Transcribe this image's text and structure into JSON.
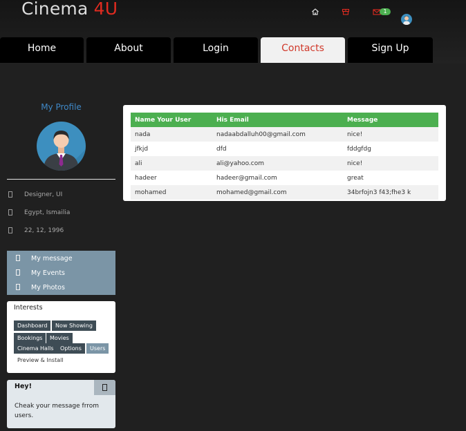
{
  "brand": {
    "name": "Cinema",
    "accent": "4U"
  },
  "header_icons": [
    {
      "name": "home-icon"
    },
    {
      "name": "store-icon",
      "color": "#e02b20"
    },
    {
      "name": "mail-icon",
      "color": "#e02b20",
      "badge": "1"
    },
    {
      "name": "user-avatar"
    }
  ],
  "nav": {
    "tabs": [
      {
        "label": "Home",
        "active": false
      },
      {
        "label": "About",
        "active": false
      },
      {
        "label": "Login",
        "active": false
      },
      {
        "label": "Contacts",
        "active": true
      },
      {
        "label": "Sign Up",
        "active": false
      }
    ]
  },
  "sidebar": {
    "profile_title": "My Profile",
    "info": [
      {
        "text": "Designer, UI"
      },
      {
        "text": "Egypt, Ismailia"
      },
      {
        "text": "22, 12, 1996"
      }
    ],
    "menu": [
      {
        "label": "My message"
      },
      {
        "label": "My Events"
      },
      {
        "label": "My Photos"
      }
    ],
    "interests": {
      "title": "Interests",
      "tags": [
        {
          "label": "Dashboard",
          "style": "dark"
        },
        {
          "label": "Now Showing",
          "style": "dark"
        },
        {
          "label": "Bookings",
          "style": "dark"
        },
        {
          "label": "Movies",
          "style": "dark"
        },
        {
          "label": "Cinema Halls",
          "style": "dark"
        },
        {
          "label": "Options",
          "style": "dark"
        },
        {
          "label": "Users",
          "style": "light"
        },
        {
          "label": "Preview & Install",
          "style": "plain"
        }
      ]
    },
    "hey": {
      "title": "Hey!",
      "text": "Cheak your message frrom users."
    }
  },
  "contacts_table": {
    "headers": [
      "Name Your User",
      "His Email",
      "Message"
    ],
    "rows": [
      [
        "nada",
        "nadaabdalluh00@gmail.com",
        "nice!"
      ],
      [
        "jfkjd",
        "dfd",
        "fddgfdg"
      ],
      [
        "ali",
        "ali@yahoo.com",
        "nice!"
      ],
      [
        "hadeer",
        "hadeer@gmail.com",
        "great"
      ],
      [
        "mohamed",
        "mohamed@gmail.com",
        "34brfojn3 f43;fhe3 k"
      ]
    ]
  },
  "colors": {
    "background": "#202020",
    "accent_red": "#e02b20",
    "profile_blue": "#3f88c7",
    "table_header_green": "#4caf50",
    "menu_slate": "#7b95a6",
    "tag_dark": "#3e4c55"
  }
}
